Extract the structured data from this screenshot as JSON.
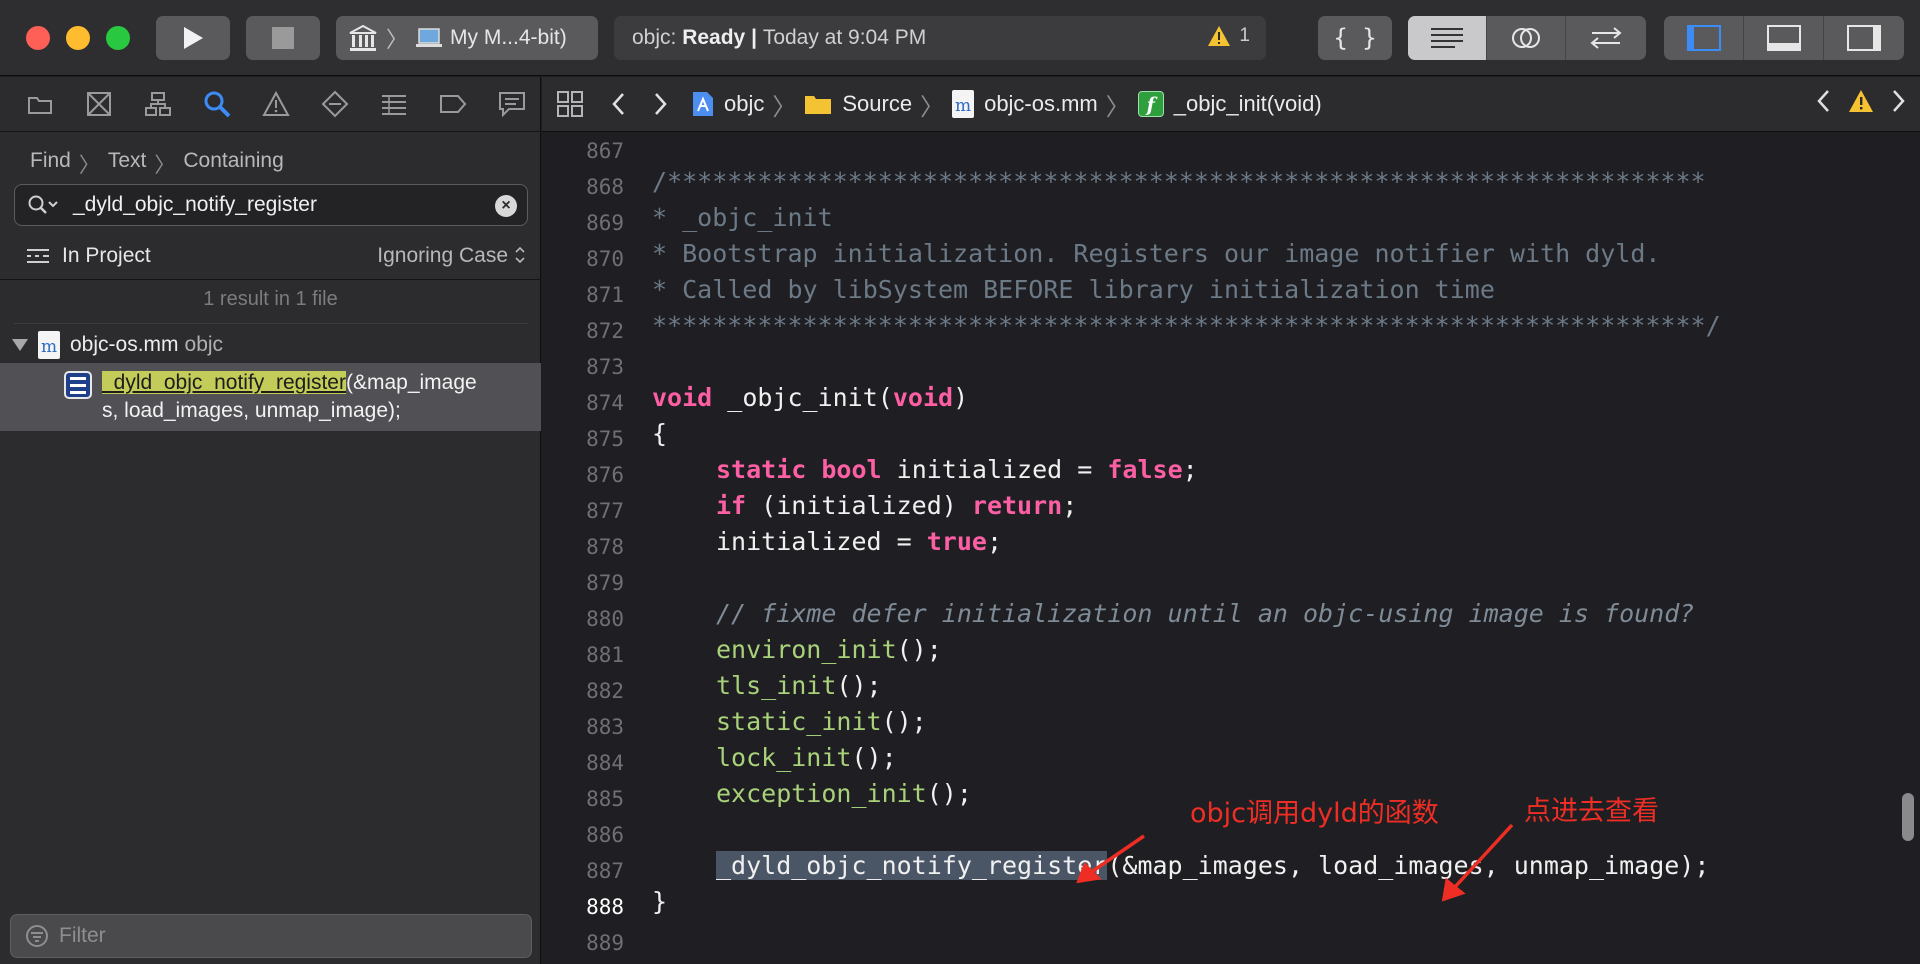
{
  "toolbar": {
    "scheme_target": "My M...4-bit)",
    "activity_project": "objc:",
    "activity_status": "Ready",
    "activity_divider": "|",
    "activity_time": "Today at 9:04 PM",
    "warning_count": "1",
    "braces_label": "{ }"
  },
  "navigator": {
    "breadcrumb": [
      "Find",
      "Text",
      "Containing"
    ],
    "search_query": "_dyld_objc_notify_register",
    "scope": "In Project",
    "case_option": "Ignoring Case",
    "result_summary": "1 result in 1 file",
    "file": {
      "name": "objc-os.mm",
      "group": "objc",
      "icon_letter": "m"
    },
    "match": {
      "highlight": "_dyld_objc_notify_register",
      "rest_line1": "(&map_image",
      "rest_line2": "s, load_images, unmap_image);"
    },
    "filter_placeholder": "Filter"
  },
  "jumpbar": {
    "project": "objc",
    "folder": "Source",
    "file": "objc-os.mm",
    "symbol": "_objc_init(void)",
    "symbol_badge": "f"
  },
  "editor": {
    "current_line": "888",
    "lines": [
      {
        "n": "867",
        "code": ""
      },
      {
        "n": "868",
        "code": ""
      },
      {
        "n": "869",
        "code": "/*********************************************************************"
      },
      {
        "n": "870",
        "code": "* _objc_init"
      },
      {
        "n": "871",
        "code": "* Bootstrap initialization. Registers our image notifier with dyld."
      },
      {
        "n": "872",
        "code": "* Called by libSystem BEFORE library initialization time"
      },
      {
        "n": "873",
        "code": "**********************************************************************/"
      },
      {
        "n": "874",
        "code": ""
      },
      {
        "n": "875",
        "code": "void _objc_init(void)"
      },
      {
        "n": "876",
        "code": "{"
      },
      {
        "n": "877",
        "code": "    static bool initialized = false;"
      },
      {
        "n": "878",
        "code": "    if (initialized) return;"
      },
      {
        "n": "879",
        "code": "    initialized = true;"
      },
      {
        "n": "880",
        "code": ""
      },
      {
        "n": "881",
        "code": "    // fixme defer initialization until an objc-using image is found?"
      },
      {
        "n": "882",
        "code": "    environ_init();"
      },
      {
        "n": "883",
        "code": "    tls_init();"
      },
      {
        "n": "884",
        "code": "    static_init();"
      },
      {
        "n": "885",
        "code": "    lock_init();"
      },
      {
        "n": "886",
        "code": "    exception_init();"
      },
      {
        "n": "887",
        "code": ""
      },
      {
        "n": "888",
        "code": "    _dyld_objc_notify_register(&map_images, load_images, unmap_image);"
      },
      {
        "n": "889",
        "code": "}"
      }
    ],
    "tokens": {
      "comment_open": "/*********************************************************************",
      "comment_l1": "* _objc_init",
      "comment_l2": "* Bootstrap initialization. Registers our image notifier with dyld.",
      "comment_l3": "* Called by libSystem BEFORE library initialization time",
      "comment_close": "**********************************************************************/",
      "void": "void",
      "objc_init_sig": " _objc_init(",
      "void2": "void",
      "close_paren": ")",
      "open_brace": "{",
      "static": "static",
      "bool": "bool",
      "init_false_a": " initialized = ",
      "false": "false",
      "semi": ";",
      "if": "if",
      "if_cond": " (initialized) ",
      "return": "return",
      "init_true_a": "initialized = ",
      "true": "true",
      "fixme": "// fixme defer initialization until an objc-using image is found?",
      "environ_init": "environ_init",
      "tls_init": "tls_init",
      "static_init": "static_init",
      "lock_init": "lock_init",
      "exception_init": "exception_init",
      "call_tail": "();",
      "register_fn": "_dyld_objc_notify_register",
      "register_args": "(&map_images, load_images, unmap_image);",
      "close_brace": "}"
    }
  },
  "annotations": {
    "note1": "objc调用dyld的函数",
    "note2": "点进去查看",
    "color": "#ee2e24"
  },
  "colors": {
    "keyword": "#fc5fa3",
    "comment": "#6c7986",
    "function": "#a8d17a",
    "search_highlight": "#c4cc59"
  }
}
